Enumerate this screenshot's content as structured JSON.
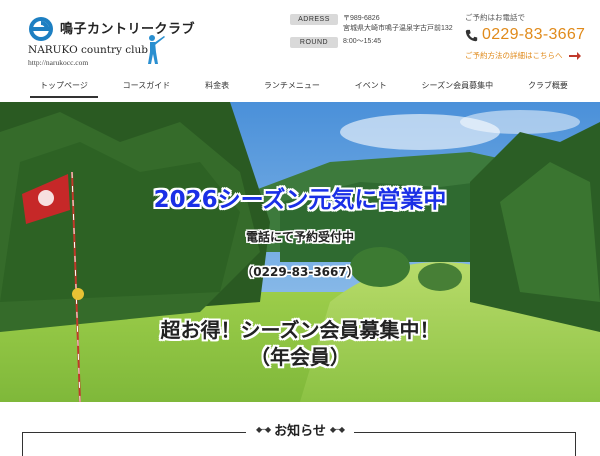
{
  "header": {
    "logo_jp": "鳴子カントリークラブ",
    "logo_en": "NARUKO country club",
    "logo_url": "http://narukocc.com",
    "address_tag": "ADRESS",
    "address_zip": "〒989-6826",
    "address_line": "宮城県大崎市鳴子温泉字古戸前132",
    "round_tag": "ROUND",
    "round_hours": "8:00～15:45",
    "contact_label": "ご予約はお電話で",
    "phone": "0229-83-3667",
    "reservation_link": "ご予約方法の詳細はこちらへ",
    "accent_color": "#e08a1a"
  },
  "nav": {
    "items": [
      {
        "label": "トップページ"
      },
      {
        "label": "コースガイド"
      },
      {
        "label": "料金表"
      },
      {
        "label": "ランチメニュー"
      },
      {
        "label": "イベント"
      },
      {
        "label": "シーズン会員募集中"
      },
      {
        "label": "クラブ概要"
      }
    ]
  },
  "hero": {
    "title": "2026シーズン元気に営業中",
    "line1": "電話にて予約受付中",
    "line2": "（0229-83-3667）",
    "line3": "超お得！シーズン会員募集中！",
    "line4": "（年会員）",
    "title_color": "#1a2fe6"
  },
  "news": {
    "title": "お知らせ"
  }
}
